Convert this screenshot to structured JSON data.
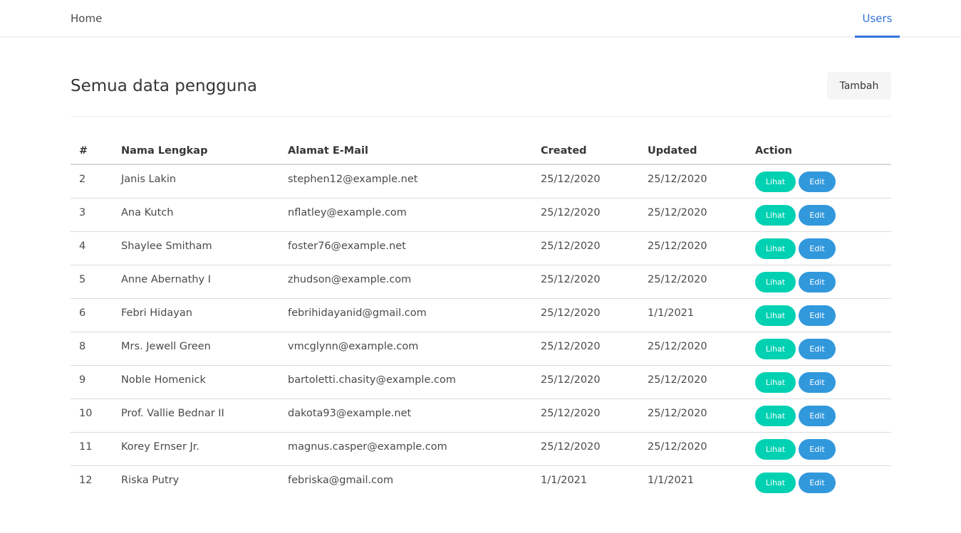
{
  "nav": {
    "home": "Home",
    "users": "Users"
  },
  "header": {
    "title": "Semua data pengguna",
    "add_button": "Tambah"
  },
  "table": {
    "columns": [
      "#",
      "Nama Lengkap",
      "Alamat E-Mail",
      "Created",
      "Updated",
      "Action"
    ],
    "action_labels": {
      "view": "Lihat",
      "edit": "Edit"
    },
    "rows": [
      [
        "2",
        "Janis Lakin",
        "stephen12@example.net",
        "25/12/2020",
        "25/12/2020"
      ],
      [
        "3",
        "Ana Kutch",
        "nflatley@example.com",
        "25/12/2020",
        "25/12/2020"
      ],
      [
        "4",
        "Shaylee Smitham",
        "foster76@example.net",
        "25/12/2020",
        "25/12/2020"
      ],
      [
        "5",
        "Anne Abernathy I",
        "zhudson@example.com",
        "25/12/2020",
        "25/12/2020"
      ],
      [
        "6",
        "Febri Hidayan",
        "febrihidayanid@gmail.com",
        "25/12/2020",
        "1/1/2021"
      ],
      [
        "8",
        "Mrs. Jewell Green",
        "vmcglynn@example.com",
        "25/12/2020",
        "25/12/2020"
      ],
      [
        "9",
        "Noble Homenick",
        "bartoletti.chasity@example.com",
        "25/12/2020",
        "25/12/2020"
      ],
      [
        "10",
        "Prof. Vallie Bednar II",
        "dakota93@example.net",
        "25/12/2020",
        "25/12/2020"
      ],
      [
        "11",
        "Korey Ernser Jr.",
        "magnus.casper@example.com",
        "25/12/2020",
        "25/12/2020"
      ],
      [
        "12",
        "Riska Putry",
        "febriska@gmail.com",
        "1/1/2021",
        "1/1/2021"
      ]
    ]
  },
  "colors": {
    "primary": "#3273dc",
    "success": "#00d1b2",
    "info": "#3298dc"
  }
}
